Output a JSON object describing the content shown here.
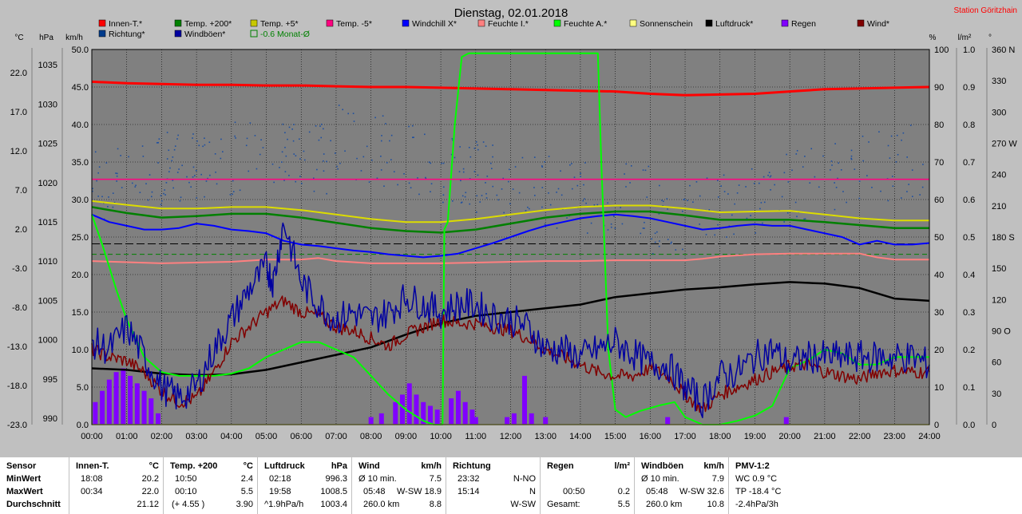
{
  "title": "Dienstag, 02.01.2018",
  "station": "Station Göritzhain",
  "axis_units": {
    "temp": "°C",
    "pressure": "hPa",
    "wind": "km/h",
    "humidity": "%",
    "rain": "l/m²",
    "direction": "°"
  },
  "legend": [
    {
      "name": "Innen-T.*",
      "color": "#ff0000"
    },
    {
      "name": "Temp. +200*",
      "color": "#008000"
    },
    {
      "name": "Temp. +5*",
      "color": "#c8c800"
    },
    {
      "name": "Temp. -5*",
      "color": "#ff0080"
    },
    {
      "name": "Windchill X*",
      "color": "#0000ff"
    },
    {
      "name": "Feuchte I.*",
      "color": "#ff8080"
    },
    {
      "name": "Feuchte A.*",
      "color": "#00ff00"
    },
    {
      "name": "Sonnenschein",
      "color": "#ffff80"
    },
    {
      "name": "Luftdruck*",
      "color": "#000000"
    },
    {
      "name": "Regen",
      "color": "#8000ff"
    },
    {
      "name": "Wind*",
      "color": "#800000"
    },
    {
      "name": "Richtung*",
      "color": "#003c8c"
    },
    {
      "name": "Windböen*",
      "color": "#0000a0"
    },
    {
      "name": "-0.6 Monat-Ø",
      "color": "#008000"
    }
  ],
  "chart_data": {
    "type": "line",
    "title": "Dienstag, 02.01.2018",
    "x_ticks": [
      "00:00",
      "01:00",
      "02:00",
      "03:00",
      "04:00",
      "05:00",
      "06:00",
      "07:00",
      "08:00",
      "09:00",
      "10:00",
      "11:00",
      "12:00",
      "13:00",
      "14:00",
      "15:00",
      "16:00",
      "17:00",
      "18:00",
      "19:00",
      "20:00",
      "21:00",
      "22:00",
      "23:00",
      "24:00"
    ],
    "temp_ticks": [
      "22.0",
      "17.0",
      "12.0",
      "7.0",
      "2.0",
      "-3.0",
      "-8.0",
      "-13.0",
      "-18.0",
      "-23.0"
    ],
    "pressure_ticks": [
      "1035",
      "1030",
      "1025",
      "1020",
      "1015",
      "1010",
      "1005",
      "1000",
      "995",
      "990"
    ],
    "wind_ticks": [
      "50.0",
      "45.0",
      "40.0",
      "35.0",
      "30.0",
      "25.0",
      "20.0",
      "15.0",
      "10.0",
      "5.0",
      "0.0"
    ],
    "humidity_ticks": [
      "100",
      "90",
      "80",
      "70",
      "60",
      "50",
      "40",
      "30",
      "20",
      "10",
      "0"
    ],
    "rain_ticks": [
      "1.0",
      "0.9",
      "0.8",
      "0.7",
      "0.6",
      "0.5",
      "0.4",
      "0.3",
      "0.2",
      "0.1",
      "0.0"
    ],
    "direction_ticks": [
      "360 N",
      "330",
      "300",
      "270 W",
      "240",
      "210",
      "180 S",
      "150",
      "120",
      "90 O",
      "60",
      "30",
      "0"
    ],
    "wind_range": [
      0,
      50
    ],
    "series": [
      {
        "name": "Innen-T.*",
        "color": "#ff0000",
        "x": [
          0,
          1,
          2,
          3,
          4,
          5,
          6,
          7,
          8,
          9,
          10,
          11,
          12,
          13,
          14,
          15,
          16,
          17,
          18,
          19,
          20,
          21,
          22,
          23,
          24
        ],
        "y": [
          45.7,
          45.5,
          45.4,
          45.3,
          45.3,
          45.2,
          45.2,
          45.1,
          45.0,
          45.0,
          44.9,
          44.8,
          44.7,
          44.6,
          44.5,
          44.4,
          44.1,
          43.9,
          44.0,
          44.1,
          44.4,
          44.7,
          44.8,
          44.9,
          45.0
        ]
      },
      {
        "name": "Temp. +5*",
        "color": "#dcdc00",
        "x": [
          0,
          1,
          2,
          3,
          4,
          5,
          6,
          7,
          8,
          9,
          10,
          11,
          12,
          13,
          14,
          15,
          16,
          17,
          18,
          19,
          20,
          21,
          22,
          23,
          24
        ],
        "y": [
          29.8,
          29.3,
          28.8,
          28.8,
          29.0,
          29.0,
          28.6,
          28.0,
          27.4,
          27.0,
          27.0,
          27.4,
          28.0,
          28.6,
          29.0,
          29.2,
          29.2,
          28.8,
          28.3,
          28.4,
          28.5,
          28.0,
          27.5,
          27.2,
          27.2
        ]
      },
      {
        "name": "Temp. +200*",
        "color": "#008000",
        "x": [
          0,
          1,
          2,
          3,
          4,
          5,
          6,
          7,
          8,
          9,
          10,
          11,
          12,
          13,
          14,
          15,
          16,
          17,
          18,
          19,
          20,
          21,
          22,
          23,
          24
        ],
        "y": [
          29.0,
          28.2,
          27.6,
          27.8,
          28.1,
          28.1,
          27.6,
          26.9,
          26.2,
          25.8,
          25.6,
          26.0,
          26.8,
          27.6,
          28.1,
          28.4,
          28.4,
          27.9,
          27.3,
          27.3,
          27.3,
          27.0,
          26.6,
          26.2,
          26.2
        ]
      },
      {
        "name": "Windchill X*",
        "color": "#0000ff",
        "x": [
          0,
          0.5,
          1,
          1.5,
          2,
          2.5,
          3,
          3.5,
          4,
          4.5,
          5,
          5.5,
          6,
          6.5,
          7,
          7.5,
          8,
          8.5,
          9,
          9.5,
          10,
          10.5,
          11,
          11.5,
          12,
          12.5,
          13,
          13.5,
          14,
          14.5,
          15,
          15.5,
          16,
          16.5,
          17,
          17.5,
          18,
          18.5,
          19,
          19.5,
          20,
          20.5,
          21,
          21.5,
          22,
          22.5,
          23,
          23.5,
          24
        ],
        "y": [
          28.0,
          27.0,
          26.5,
          26.0,
          26.0,
          26.2,
          26.8,
          26.5,
          26.0,
          25.8,
          25.5,
          24.5,
          24.0,
          23.8,
          23.5,
          23.2,
          23.0,
          22.7,
          22.5,
          22.3,
          22.5,
          22.8,
          23.5,
          24.2,
          25.0,
          25.8,
          26.5,
          27.0,
          27.5,
          27.8,
          28.0,
          27.8,
          27.5,
          27.0,
          26.5,
          26.0,
          26.2,
          26.5,
          26.7,
          26.5,
          26.5,
          26.0,
          25.5,
          25.0,
          24.0,
          24.5,
          24.0,
          24.0,
          24.2
        ]
      },
      {
        "name": "Feuchte I.*",
        "color": "#ff8080",
        "x": [
          0,
          2,
          4,
          5,
          6,
          6.5,
          7,
          8,
          9,
          10,
          11,
          12,
          13,
          14,
          15,
          16,
          17,
          17.5,
          18,
          19,
          20,
          21,
          22,
          22.5,
          23,
          24
        ],
        "y": [
          21.8,
          21.5,
          21.7,
          22.0,
          22.0,
          22.2,
          21.8,
          21.5,
          21.5,
          21.5,
          21.6,
          21.7,
          21.8,
          21.8,
          21.9,
          21.9,
          21.9,
          22.1,
          22.4,
          22.7,
          22.8,
          22.8,
          22.8,
          22.3,
          22.0,
          22.0
        ]
      },
      {
        "name": "Luftdruck*",
        "color": "#000000",
        "x": [
          0,
          1,
          2,
          3,
          4,
          5,
          6,
          7,
          8,
          9,
          10,
          11,
          12,
          13,
          14,
          15,
          16,
          17,
          18,
          19,
          20,
          21,
          22,
          23,
          24
        ],
        "y": [
          7.5,
          7.3,
          6.8,
          6.6,
          6.7,
          7.3,
          8.3,
          9.3,
          10.3,
          12.0,
          13.5,
          14.5,
          15.0,
          15.5,
          16.0,
          17.0,
          17.5,
          18.0,
          18.3,
          18.7,
          19.0,
          18.8,
          18.2,
          16.8,
          16.5
        ]
      },
      {
        "name": "Feuchte A.*",
        "color": "#00ff00",
        "x": [
          0,
          0.3,
          0.7,
          1,
          1.5,
          2,
          2.5,
          3,
          3.5,
          4,
          4.5,
          5,
          5.5,
          6,
          6.5,
          7,
          7.5,
          8,
          8.5,
          9,
          9.5,
          9.8,
          9.85,
          10.05,
          10.1,
          10.2,
          10.4,
          10.6,
          10.8,
          11,
          12,
          13,
          14,
          14.2,
          14.4,
          14.5,
          14.6,
          14.8,
          15,
          15.3,
          15.7,
          16,
          16.3,
          16.7,
          17,
          17.5,
          18,
          18.5,
          19,
          19.5,
          20,
          20.5,
          21,
          21.5,
          22,
          22.5,
          23,
          23.5,
          24
        ],
        "y": [
          28,
          24,
          18,
          14,
          9,
          7,
          6.5,
          6.5,
          6.5,
          6.8,
          7.5,
          9,
          10,
          11,
          11,
          10,
          9,
          6.5,
          4,
          2,
          0.5,
          0,
          0,
          0,
          26,
          27,
          40,
          49,
          49.5,
          49.5,
          49.5,
          49.5,
          49.5,
          49.5,
          49.5,
          49.5,
          35,
          10,
          2,
          1,
          1.8,
          2.2,
          2.6,
          3,
          1.0,
          0,
          0,
          0.5,
          1.2,
          2.5,
          7.5,
          8.5,
          10,
          9.5,
          8,
          8,
          9,
          9,
          9
        ]
      },
      {
        "name": "Wind*",
        "color": "#800000",
        "x": [
          0,
          0.5,
          1,
          1.5,
          2,
          2.5,
          3,
          3.5,
          4,
          4.5,
          5,
          5.5,
          6,
          6.5,
          7,
          7.5,
          8,
          8.5,
          9,
          9.5,
          10,
          10.5,
          11,
          11.5,
          12,
          12.5,
          13,
          13.5,
          14,
          14.5,
          15,
          15.5,
          16,
          16.5,
          17,
          17.5,
          18,
          18.5,
          19,
          19.5,
          20,
          20.5,
          21,
          21.5,
          22,
          22.5,
          23,
          23.5,
          24
        ],
        "y": [
          10,
          9,
          8.5,
          7,
          4.5,
          3,
          3.5,
          7,
          11,
          13,
          15,
          16.5,
          15,
          14.5,
          13,
          12.5,
          11.5,
          10.5,
          12,
          13,
          14,
          13.5,
          13.5,
          13,
          12.5,
          11.5,
          10,
          9,
          8,
          7,
          6.5,
          6.5,
          7.5,
          6.5,
          4,
          2,
          4,
          5,
          6,
          7,
          7.8,
          8,
          7,
          6.5,
          6,
          7,
          7.2,
          7,
          7
        ]
      },
      {
        "name": "Windböen*",
        "color": "#0000a0",
        "x": [
          0,
          0.5,
          1,
          1.5,
          2,
          2.5,
          3,
          3.5,
          4,
          4.5,
          5,
          5.2,
          5.5,
          6,
          6.5,
          7,
          7.5,
          8,
          8.5,
          9,
          9.5,
          10,
          10.5,
          11,
          11.5,
          12,
          12.5,
          13,
          13.5,
          14,
          14.5,
          15,
          15.5,
          16,
          16.5,
          17,
          17.5,
          18,
          18.5,
          19,
          19.5,
          20,
          20.5,
          21,
          21.5,
          22,
          22.5,
          23,
          23.5,
          24
        ],
        "y": [
          11,
          10,
          13,
          9,
          5,
          3.5,
          5,
          10,
          14,
          18,
          21,
          19,
          27,
          19,
          16,
          14,
          15,
          14,
          15,
          17,
          16,
          15,
          16,
          16,
          14.5,
          14,
          13,
          10,
          10,
          9,
          10,
          11,
          9.5,
          8,
          8,
          5,
          3,
          6.5,
          7,
          9,
          10,
          8,
          9,
          9,
          9,
          9,
          9,
          9,
          9,
          8
        ]
      },
      {
        "name": "Temp. -5*",
        "color": "#ff0080",
        "x": [
          0,
          24
        ],
        "y": [
          32.7,
          32.7
        ]
      },
      {
        "name": "Sonnenschein",
        "color": "#ffff80",
        "x": [
          0,
          24
        ],
        "y": [
          0,
          0
        ]
      }
    ],
    "rain_bars": [
      {
        "x": 0.1,
        "v": 0.06
      },
      {
        "x": 0.3,
        "v": 0.09
      },
      {
        "x": 0.5,
        "v": 0.12
      },
      {
        "x": 0.7,
        "v": 0.14
      },
      {
        "x": 0.9,
        "v": 0.15
      },
      {
        "x": 1.1,
        "v": 0.13
      },
      {
        "x": 1.3,
        "v": 0.11
      },
      {
        "x": 1.5,
        "v": 0.09
      },
      {
        "x": 1.7,
        "v": 0.07
      },
      {
        "x": 1.9,
        "v": 0.03
      },
      {
        "x": 8.0,
        "v": 0.02
      },
      {
        "x": 8.3,
        "v": 0.03
      },
      {
        "x": 8.7,
        "v": 0.06
      },
      {
        "x": 8.9,
        "v": 0.08
      },
      {
        "x": 9.1,
        "v": 0.11
      },
      {
        "x": 9.3,
        "v": 0.08
      },
      {
        "x": 9.5,
        "v": 0.06
      },
      {
        "x": 9.7,
        "v": 0.05
      },
      {
        "x": 9.9,
        "v": 0.04
      },
      {
        "x": 10.3,
        "v": 0.07
      },
      {
        "x": 10.5,
        "v": 0.09
      },
      {
        "x": 10.7,
        "v": 0.06
      },
      {
        "x": 10.9,
        "v": 0.04
      },
      {
        "x": 11.0,
        "v": 0.02
      },
      {
        "x": 11.9,
        "v": 0.02
      },
      {
        "x": 12.1,
        "v": 0.03
      },
      {
        "x": 12.4,
        "v": 0.13
      },
      {
        "x": 12.6,
        "v": 0.03
      },
      {
        "x": 13.0,
        "v": 0.02
      },
      {
        "x": 16.5,
        "v": 0.02
      },
      {
        "x": 19.9,
        "v": 0.02
      }
    ],
    "direction_points_note": "scatter of wind direction samples, mostly 200-290 degrees"
  },
  "summary_table": {
    "sensor": {
      "header": "Sensor",
      "rows": [
        "MinWert",
        "MaxWert",
        "Durchschnitt"
      ]
    },
    "innen_t": {
      "header": "Innen-T.",
      "unit": "°C",
      "rows": [
        {
          "time": "18:08",
          "value": "20.2"
        },
        {
          "time": "00:34",
          "value": "22.0"
        },
        {
          "time": "",
          "value": "21.12"
        }
      ]
    },
    "temp200": {
      "header": "Temp. +200",
      "unit": "°C",
      "rows": [
        {
          "time": "10:50",
          "value": "2.4"
        },
        {
          "time": "00:10",
          "value": "5.5"
        },
        {
          "time": "(+ 4.55 )",
          "value": "3.90"
        }
      ]
    },
    "luftdruck": {
      "header": "Luftdruck",
      "unit": "hPa",
      "rows": [
        {
          "time": "02:18",
          "value": "996.3"
        },
        {
          "time": "19:58",
          "value": "1008.5"
        },
        {
          "time": "^1.9hPa/h",
          "value": "1003.4"
        }
      ]
    },
    "wind": {
      "header": "Wind",
      "unit": "km/h",
      "rows": [
        {
          "time": "Ø 10 min.",
          "mid": "",
          "value": "7.5"
        },
        {
          "time": "05:48",
          "mid": "W-SW",
          "value": "18.9"
        },
        {
          "time": "260.0 km",
          "mid": "",
          "value": "8.8"
        }
      ]
    },
    "richtung": {
      "header": "Richtung",
      "rows": [
        {
          "time": "23:32",
          "value": "N-NO"
        },
        {
          "time": "15:14",
          "value": "N"
        },
        {
          "time": "",
          "value": "W-SW"
        }
      ]
    },
    "regen": {
      "header": "Regen",
      "unit": "l/m²",
      "rows": [
        {
          "time": "",
          "value": ""
        },
        {
          "time": "00:50",
          "value": "0.2"
        },
        {
          "time": "Gesamt:",
          "value": "5.5"
        }
      ]
    },
    "windboeen": {
      "header": "Windböen",
      "unit": "km/h",
      "rows": [
        {
          "time": "Ø 10 min.",
          "mid": "",
          "value": "7.9"
        },
        {
          "time": "05:48",
          "mid": "W-SW",
          "value": "32.6"
        },
        {
          "time": "260.0 km",
          "mid": "",
          "value": "10.8"
        }
      ]
    },
    "pmv": {
      "header": "PMV-1:2",
      "rows": [
        "WC 0.9 °C",
        "TP -18.4 °C",
        "-2.4hPa/3h"
      ]
    }
  }
}
